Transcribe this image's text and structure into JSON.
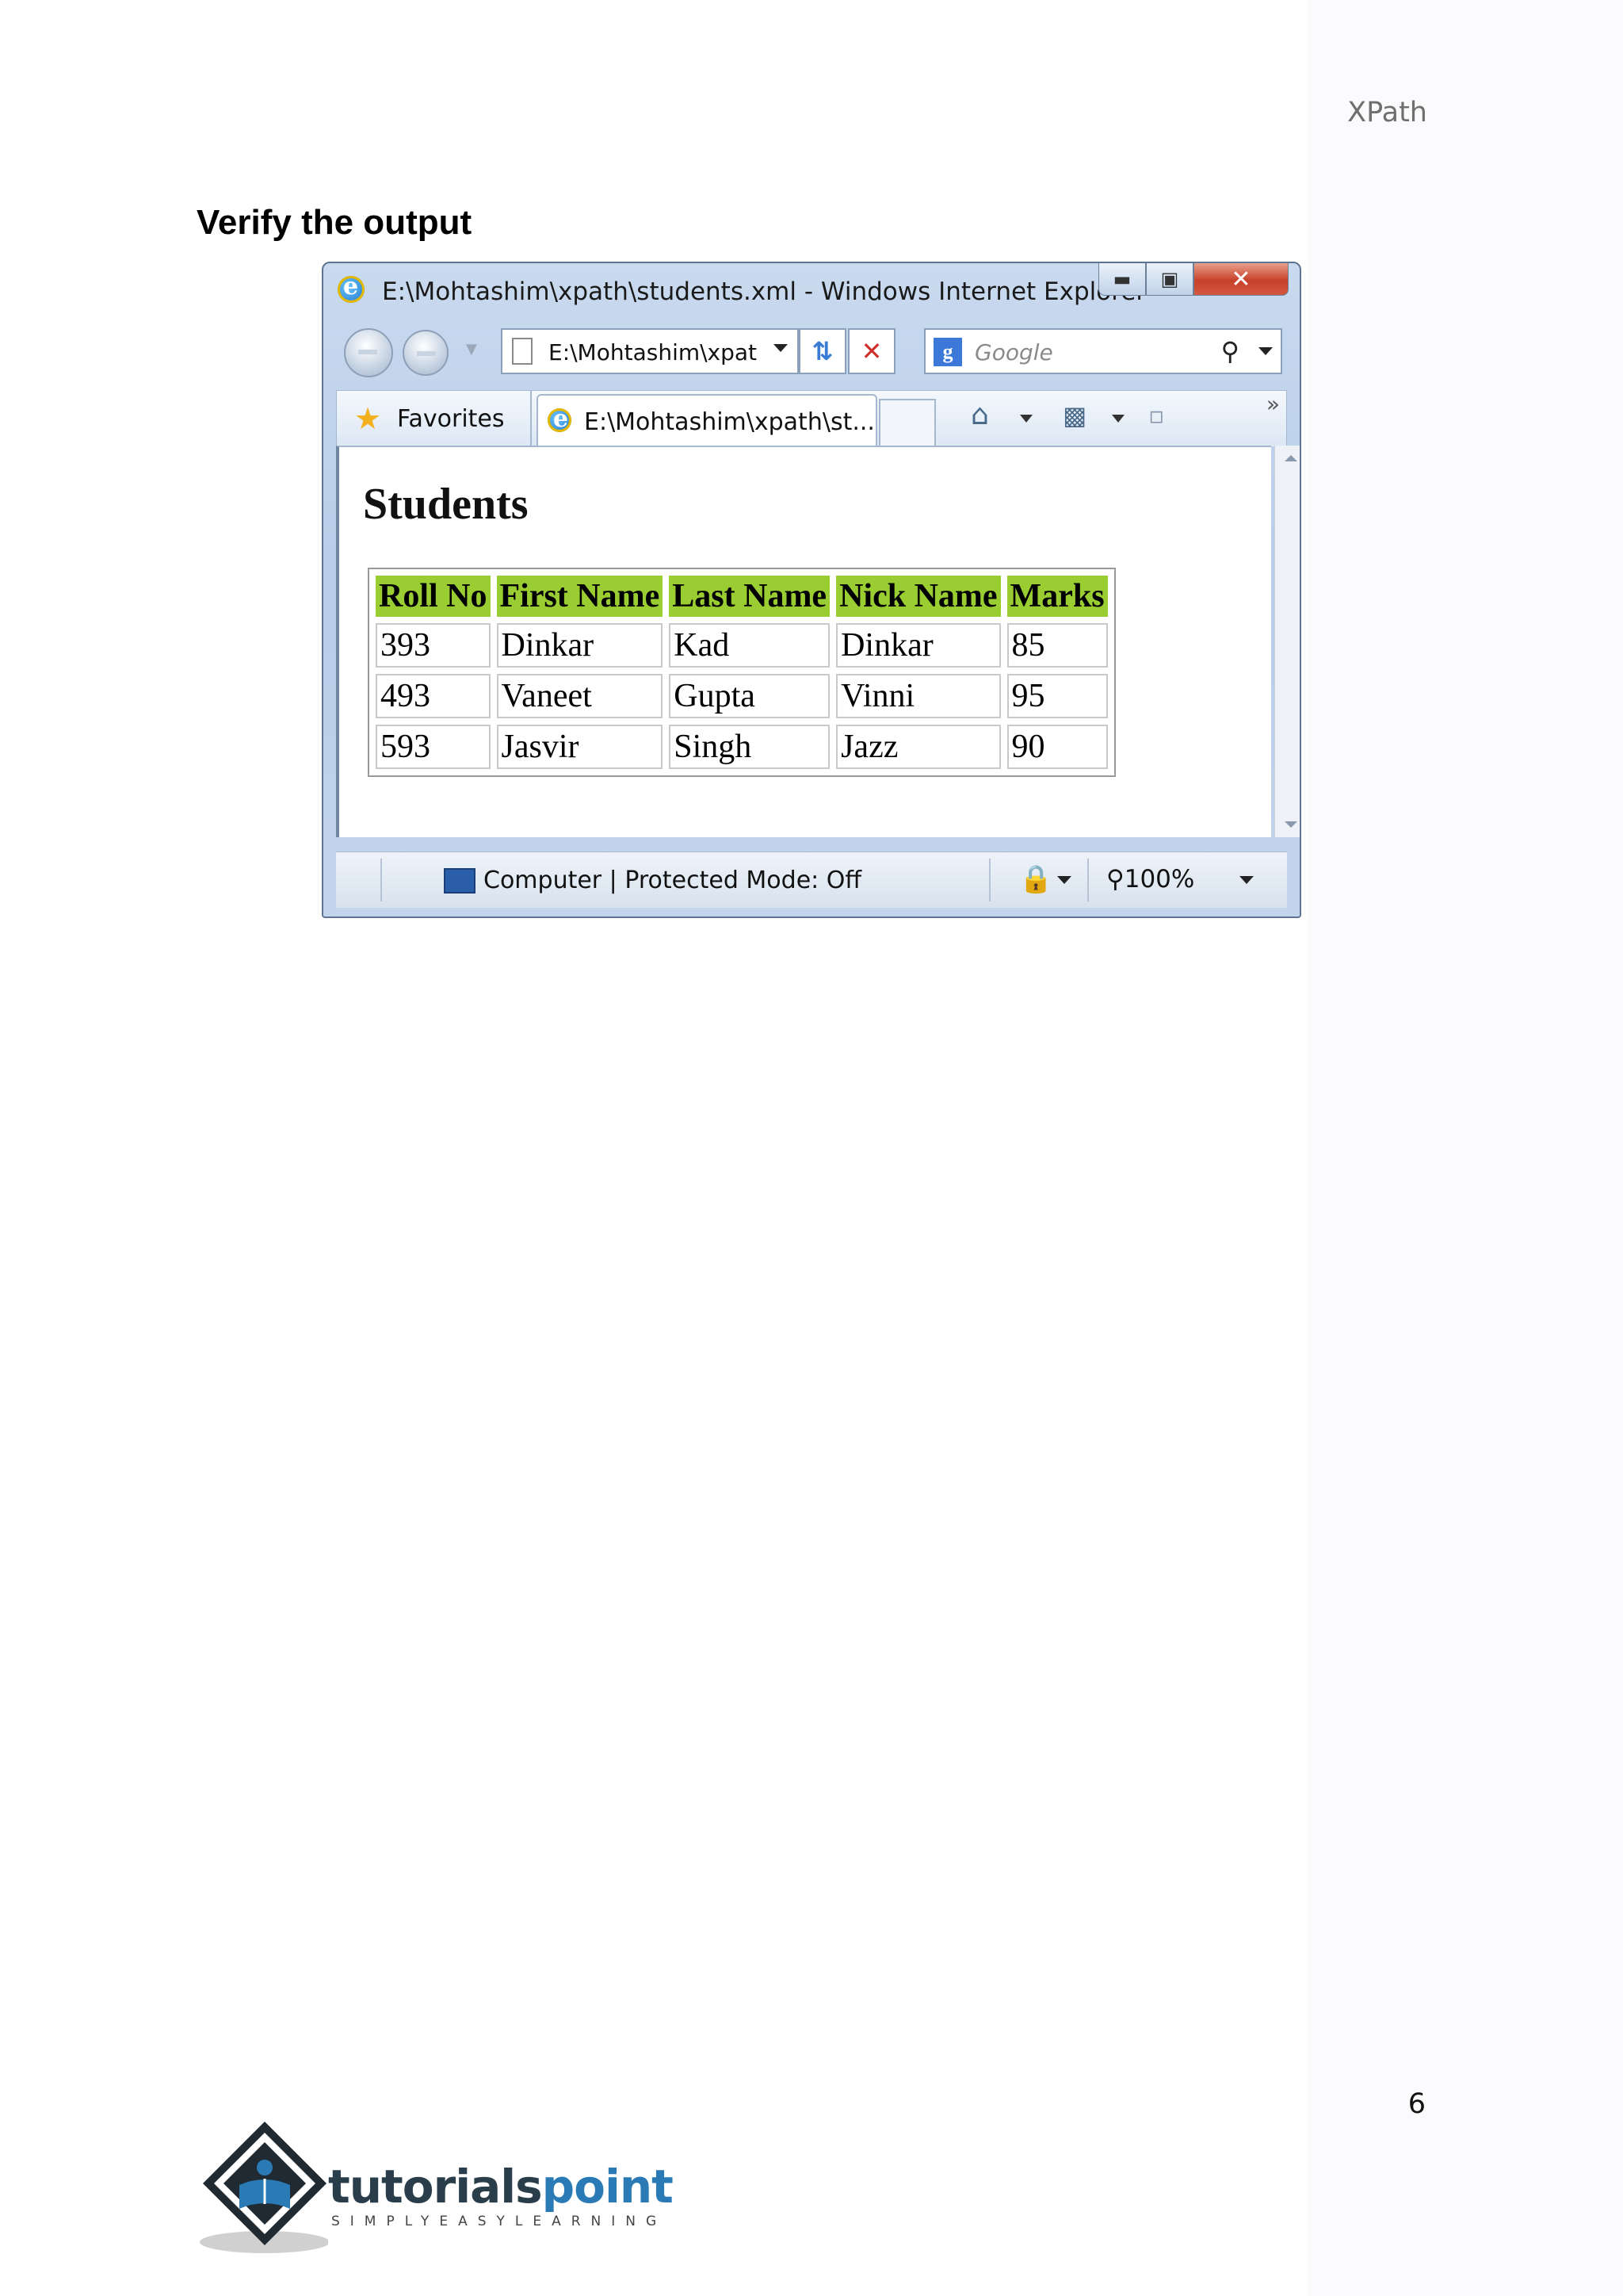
{
  "page": {
    "running_header": "XPath",
    "section_heading": "Verify the output",
    "page_number": "6"
  },
  "browser": {
    "window_title": "E:\\Mohtashim\\xpath\\students.xml - Windows Internet Explorer",
    "address_value": "E:\\Mohtashim\\xpat",
    "search_placeholder": "Google",
    "favorites_label": "Favorites",
    "tab_label": "E:\\Mohtashim\\xpath\\st...",
    "status_text": "Computer | Protected Mode: Off",
    "zoom_level": "100%",
    "icons": [
      "ie-logo-icon",
      "minimize-icon",
      "restore-icon",
      "close-icon",
      "back-icon",
      "forward-icon",
      "page-icon",
      "refresh-icon",
      "stop-icon",
      "google-icon",
      "search-icon",
      "star-icon",
      "home-icon",
      "feed-icon",
      "print-icon",
      "chevron-right-icon",
      "computer-icon",
      "lock-icon",
      "zoom-icon"
    ]
  },
  "document": {
    "title": "Students",
    "table": {
      "headers": [
        "Roll No",
        "First Name",
        "Last Name",
        "Nick Name",
        "Marks"
      ],
      "rows": [
        [
          "393",
          "Dinkar",
          "Kad",
          "Dinkar",
          "85"
        ],
        [
          "493",
          "Vaneet",
          "Gupta",
          "Vinni",
          "95"
        ],
        [
          "593",
          "Jasvir",
          "Singh",
          "Jazz",
          "90"
        ]
      ],
      "header_color": "#9acd32"
    }
  },
  "logo": {
    "word_part1": "tutorials",
    "word_part2": "point",
    "tagline": "SIMPLYEASYLEARNING"
  }
}
